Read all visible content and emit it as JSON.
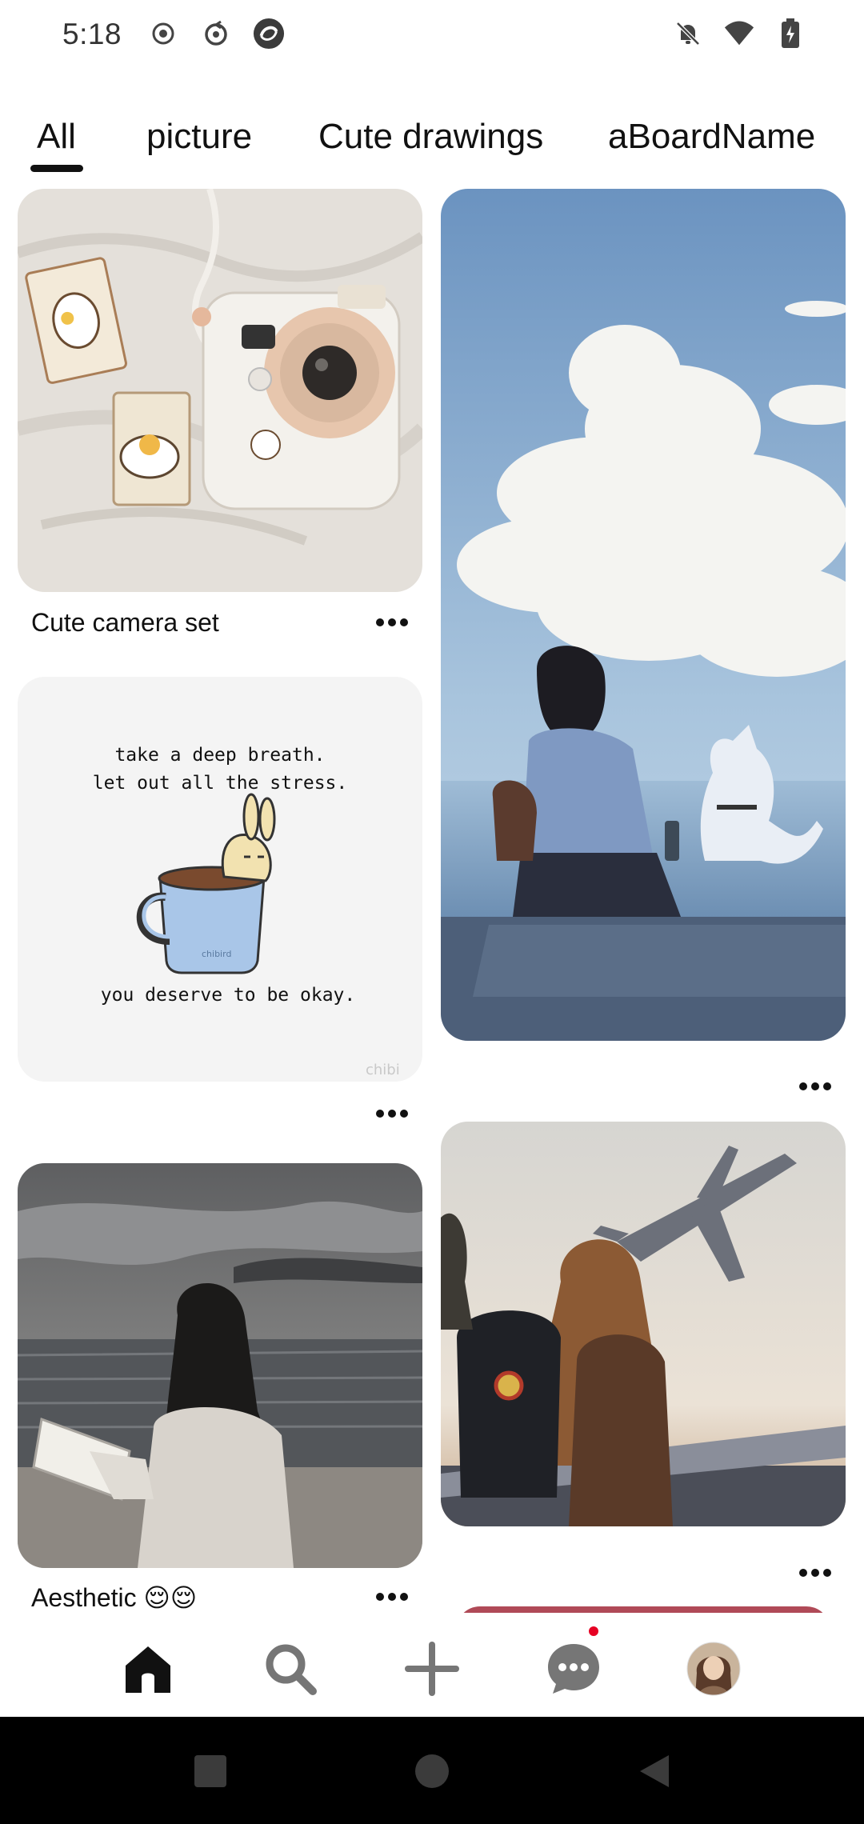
{
  "status_bar": {
    "time": "5:18",
    "left_icons": [
      "record-icon",
      "sync-icon",
      "app-icon"
    ],
    "right_icons": [
      "bell-off-icon",
      "wifi-icon",
      "battery-icon"
    ]
  },
  "tabs": {
    "items": [
      {
        "label": "All",
        "selected": true
      },
      {
        "label": "picture",
        "selected": false
      },
      {
        "label": "Cute drawings",
        "selected": false
      },
      {
        "label": "aBoardName",
        "selected": false
      }
    ]
  },
  "pins": [
    {
      "image": "instant camera with cute stickers on white sheets",
      "title": "Cute camera set"
    },
    {
      "image": "anime girl and white cat sitting by the sea under clouds",
      "title": ""
    },
    {
      "image": "illustration of bunny in a mug",
      "title": "",
      "image_text": [
        "take a deep breath.",
        "let out all the stress.",
        "you deserve to be okay.",
        "chibird",
        "chibi"
      ]
    },
    {
      "image": "girl with long hair watching airplane at sunset",
      "title": ""
    },
    {
      "image": "girl holding book at the beach in black and white",
      "title": "Aesthetic 😌😌"
    },
    {
      "image": "partially visible pin",
      "title": ""
    }
  ],
  "bottom_nav": {
    "items": [
      "home-icon",
      "search-icon",
      "create-icon",
      "messages-icon",
      "profile-avatar"
    ],
    "active": "home-icon",
    "notification_color": "#e60023"
  },
  "system_nav": [
    "recents-button",
    "home-button",
    "back-button"
  ]
}
